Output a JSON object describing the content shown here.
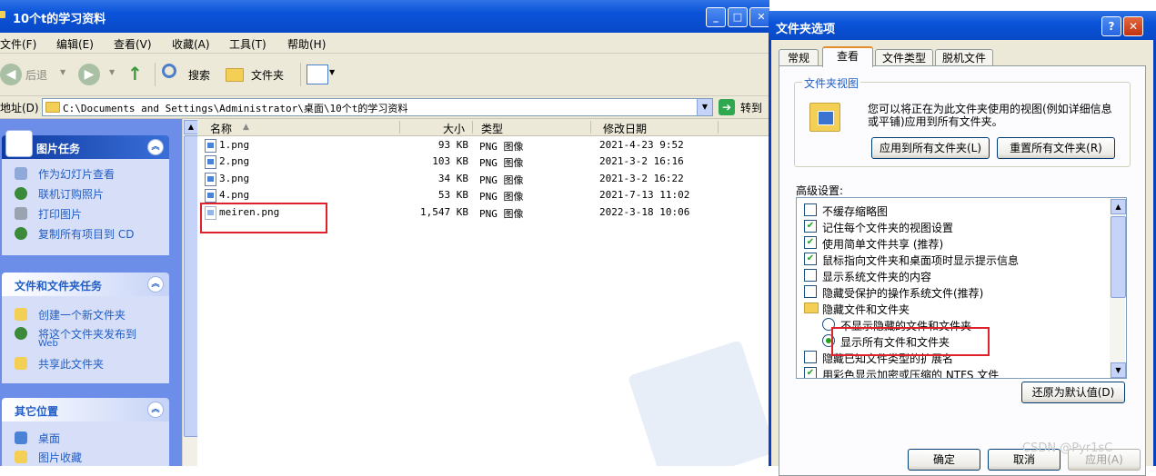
{
  "explorer": {
    "title": "10个t的学习资料",
    "menu": [
      "文件(F)",
      "编辑(E)",
      "查看(V)",
      "收藏(A)",
      "工具(T)",
      "帮助(H)"
    ],
    "toolbar": {
      "back": "后退",
      "search": "搜索",
      "folders": "文件夹"
    },
    "address": {
      "label": "地址(D)",
      "path": "C:\\Documents and Settings\\Administrator\\桌面\\10个t的学习资料",
      "go": "转到"
    },
    "tasks": {
      "picture_tasks": {
        "title": "图片任务",
        "items": [
          "作为幻灯片查看",
          "联机订购照片",
          "打印图片",
          "复制所有项目到 CD"
        ]
      },
      "file_tasks": {
        "title": "文件和文件夹任务",
        "items": [
          "创建一个新文件夹",
          "将这个文件夹发布到",
          "Web",
          "共享此文件夹"
        ]
      },
      "other_places": {
        "title": "其它位置",
        "items": [
          "桌面",
          "图片收藏"
        ]
      }
    },
    "columns": {
      "name": "名称",
      "size": "大小",
      "type": "类型",
      "modified": "修改日期"
    },
    "files": [
      {
        "name": "1.png",
        "size": "93 KB",
        "type": "PNG 图像",
        "modified": "2021-4-23 9:52"
      },
      {
        "name": "2.png",
        "size": "103 KB",
        "type": "PNG 图像",
        "modified": "2021-3-2 16:16"
      },
      {
        "name": "3.png",
        "size": "34 KB",
        "type": "PNG 图像",
        "modified": "2021-3-2 16:22"
      },
      {
        "name": "4.png",
        "size": "53 KB",
        "type": "PNG 图像",
        "modified": "2021-7-13 11:02"
      },
      {
        "name": "meiren.png",
        "size": "1,547 KB",
        "type": "PNG 图像",
        "modified": "2022-3-18 10:06"
      }
    ]
  },
  "dialog": {
    "title": "文件夹选项",
    "tabs": [
      "常规",
      "查看",
      "文件类型",
      "脱机文件"
    ],
    "folder_views": {
      "legend": "文件夹视图",
      "text": "您可以将正在为此文件夹使用的视图(例如详细信息或平铺)应用到所有文件夹。",
      "apply_all": "应用到所有文件夹(L)",
      "reset_all": "重置所有文件夹(R)"
    },
    "advanced_label": "高级设置:",
    "advanced": [
      {
        "label": "不缓存缩略图",
        "kind": "checkbox",
        "checked": false
      },
      {
        "label": "记住每个文件夹的视图设置",
        "kind": "checkbox",
        "checked": true
      },
      {
        "label": "使用简单文件共享 (推荐)",
        "kind": "checkbox",
        "checked": true
      },
      {
        "label": "鼠标指向文件夹和桌面项时显示提示信息",
        "kind": "checkbox",
        "checked": true
      },
      {
        "label": "显示系统文件夹的内容",
        "kind": "checkbox",
        "checked": false
      },
      {
        "label": "隐藏受保护的操作系统文件(推荐)",
        "kind": "checkbox",
        "checked": false
      },
      {
        "label": "隐藏文件和文件夹",
        "kind": "folder"
      },
      {
        "label": "不显示隐藏的文件和文件夹",
        "kind": "radio",
        "checked": false
      },
      {
        "label": "显示所有文件和文件夹",
        "kind": "radio",
        "checked": true
      },
      {
        "label": "隐藏已知文件类型的扩展名",
        "kind": "checkbox",
        "checked": false
      },
      {
        "label": "用彩色显示加密或压缩的 NTFS 文件",
        "kind": "checkbox",
        "checked": true
      }
    ],
    "restore_defaults": "还原为默认值(D)",
    "ok": "确定",
    "cancel": "取消",
    "apply": "应用(A)"
  },
  "watermark": "CSDN @Pyr1sC"
}
